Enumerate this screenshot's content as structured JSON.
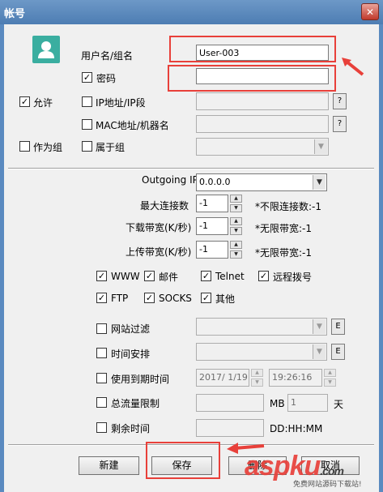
{
  "window": {
    "title": "帐号",
    "close_glyph": "✕"
  },
  "account": {
    "username_label": "用户名/组名",
    "username_value": "User-003",
    "password_label": "密码",
    "password_checked": true,
    "allow_label": "允许",
    "allow_checked": true,
    "ip_label": "IP地址/IP段",
    "ip_help": "?",
    "mac_label": "MAC地址/机器名",
    "mac_help": "?",
    "as_group_label": "作为组",
    "belongs_group_label": "属于组"
  },
  "network": {
    "outgoing_ip_label": "Outgoing IP",
    "outgoing_ip_value": "0.0.0.0",
    "max_conn_label": "最大连接数",
    "max_conn_value": "-1",
    "max_conn_hint": "*不限连接数:-1",
    "download_label": "下载带宽(K/秒)",
    "download_value": "-1",
    "download_hint": "*无限带宽:-1",
    "upload_label": "上传带宽(K/秒)",
    "upload_value": "-1",
    "upload_hint": "*无限带宽:-1"
  },
  "services": [
    {
      "label": "WWW",
      "checked": true
    },
    {
      "label": "邮件",
      "checked": true
    },
    {
      "label": "Telnet",
      "checked": true
    },
    {
      "label": "远程拨号",
      "checked": true
    },
    {
      "label": "FTP",
      "checked": true
    },
    {
      "label": "SOCKS",
      "checked": true
    },
    {
      "label": "其他",
      "checked": true
    }
  ],
  "limits": {
    "web_filter_label": "网站过滤",
    "web_filter_btn": "E",
    "schedule_label": "时间安排",
    "schedule_btn": "E",
    "expiry_label": "使用到期时间",
    "expiry_date": "2017/ 1/19",
    "expiry_time": "19:26:16",
    "traffic_label": "总流量限制",
    "traffic_unit": "MB",
    "traffic_value": "1",
    "traffic_unit2": "天",
    "remaining_label": "剩余时间",
    "remaining_format": "DD:HH:MM"
  },
  "buttons": {
    "new": "新建",
    "save": "保存",
    "delete": "删除",
    "cancel": "取消"
  },
  "watermark": {
    "logo": "aspku",
    "logo_suffix": ".com",
    "tagline": "免费网站源码下载站!"
  },
  "colors": {
    "accent_red": "#e8403a",
    "avatar": "#3aaea0",
    "title_bar": "#5a8ac0"
  }
}
